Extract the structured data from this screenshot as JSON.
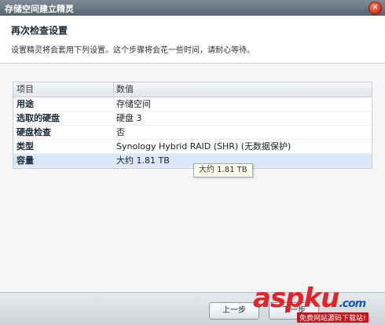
{
  "window": {
    "title": "存储空间建立精灵",
    "close_symbol": "✕"
  },
  "header": {
    "heading": "再次检查设置",
    "description": "设置精灵将会套用下列设置。这个步骤将会花一些时间，请耐心等待。"
  },
  "table": {
    "columns": [
      "项目",
      "数值"
    ],
    "rows": [
      {
        "label": "用途",
        "value": "存储空间"
      },
      {
        "label": "选取的硬盘",
        "value": "硬盘 3"
      },
      {
        "label": "硬盘检查",
        "value": "否"
      },
      {
        "label": "类型",
        "value": "Synology Hybrid RAID (SHR) (无数据保护)"
      },
      {
        "label": "容量",
        "value": "大约 1.81 TB"
      }
    ]
  },
  "tooltip": "大约 1.81 TB",
  "footer": {
    "back_label": "上一步",
    "next_label": "下一步"
  },
  "watermark": {
    "brand": "aspku",
    "tld": ".com",
    "tagline": "免费网站源码下载站!"
  }
}
